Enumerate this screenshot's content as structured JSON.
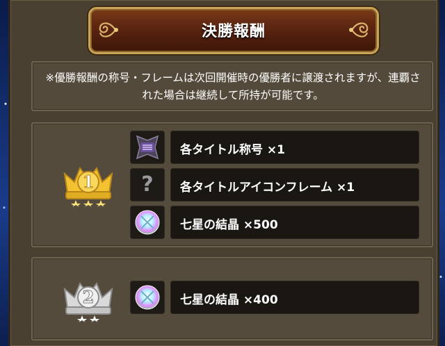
{
  "header": {
    "title": "決勝報酬"
  },
  "notice": {
    "text": "※優勝報酬の称号・フレームは次回開催時の優勝者に譲渡されますが、連覇された場合は継続して所持が可能です。"
  },
  "rewards": [
    {
      "rank": "1",
      "rank_badge_icon": "gold-crown-rank-1-icon",
      "items": [
        {
          "icon": "title-badge-icon",
          "label": "各タイトル称号 ×1"
        },
        {
          "icon": "question-mark-icon",
          "icon_text": "?",
          "label": "各タイトルアイコンフレーム ×1"
        },
        {
          "icon": "seven-star-crystal-icon",
          "label": "七星の結晶 ×500"
        }
      ]
    },
    {
      "rank": "2",
      "rank_badge_icon": "silver-crown-rank-2-icon",
      "items": [
        {
          "icon": "seven-star-crystal-icon",
          "label": "七星の結晶 ×400"
        }
      ]
    }
  ],
  "colors": {
    "panel": "#4a4032",
    "banner": "#5a2410",
    "banner_border": "#c9a35a",
    "gold": "#f2c230",
    "silver": "#d9d9d9"
  }
}
